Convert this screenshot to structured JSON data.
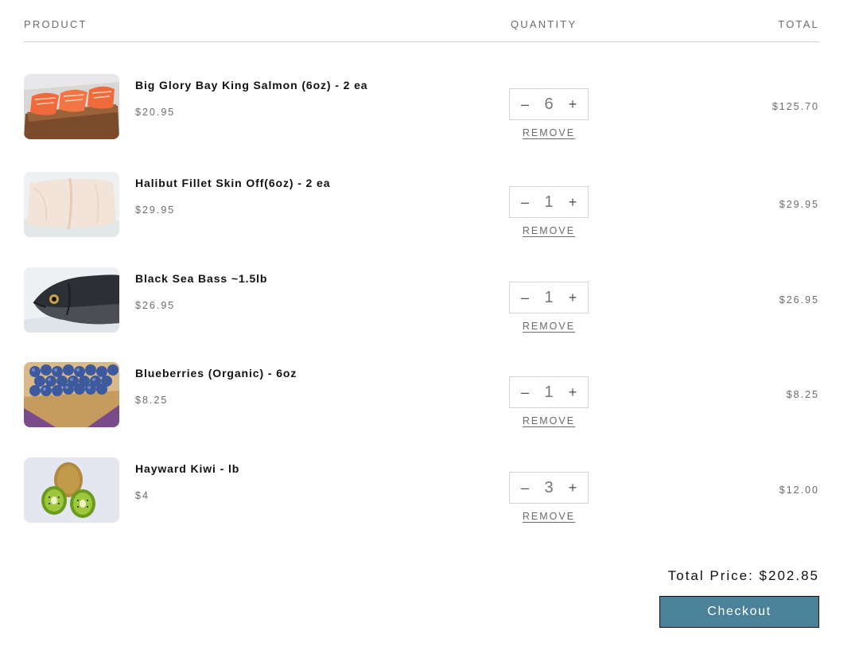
{
  "header": {
    "product": "PRODUCT",
    "quantity": "QUANTITY",
    "total": "TOTAL"
  },
  "remove_label": "REMOVE",
  "items": [
    {
      "name": "Big Glory Bay King Salmon (6oz) - 2 ea",
      "price": "$20.95",
      "quantity": "6",
      "total": "$125.70",
      "image": "salmon-fillets"
    },
    {
      "name": "Halibut Fillet Skin Off(6oz) - 2 ea",
      "price": "$29.95",
      "quantity": "1",
      "total": "$29.95",
      "image": "halibut-fillet"
    },
    {
      "name": "Black Sea Bass ~1.5lb",
      "price": "$26.95",
      "quantity": "1",
      "total": "$26.95",
      "image": "black-sea-bass"
    },
    {
      "name": "Blueberries (Organic) - 6oz",
      "price": "$8.25",
      "quantity": "1",
      "total": "$8.25",
      "image": "blueberries-box"
    },
    {
      "name": "Hayward Kiwi - lb",
      "price": "$4",
      "quantity": "3",
      "total": "$12.00",
      "image": "kiwi-fruit"
    }
  ],
  "summary": {
    "total_price": "Total Price: $202.85",
    "checkout_label": "Checkout"
  },
  "colors": {
    "checkout_bg": "#4b8299",
    "muted_text": "#6b6b6b",
    "divider": "#cfcfcf"
  },
  "icons": {
    "decrement": "minus-icon",
    "increment": "plus-icon"
  }
}
